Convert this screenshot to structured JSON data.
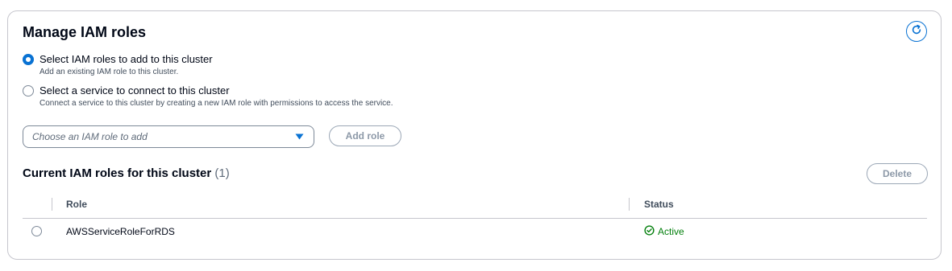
{
  "panel": {
    "title": "Manage IAM roles",
    "refresh_icon": "refresh-icon"
  },
  "options": [
    {
      "label": "Select IAM roles to add to this cluster",
      "description": "Add an existing IAM role to this cluster.",
      "selected": true
    },
    {
      "label": "Select a service to connect to this cluster",
      "description": "Connect a service to this cluster by creating a new IAM role with permissions to access the service.",
      "selected": false
    }
  ],
  "role_select": {
    "placeholder": "Choose an IAM role to add",
    "icon": "caret-down-icon"
  },
  "add_role_button": "Add role",
  "current_roles": {
    "title": "Current IAM roles for this cluster",
    "count": "(1)",
    "delete_button": "Delete",
    "columns": [
      "Role",
      "Status"
    ],
    "rows": [
      {
        "role": "AWSServiceRoleForRDS",
        "status": "Active"
      }
    ]
  },
  "colors": {
    "accent": "#0972d3",
    "success": "#037f0c",
    "border": "#c6c6cd"
  }
}
